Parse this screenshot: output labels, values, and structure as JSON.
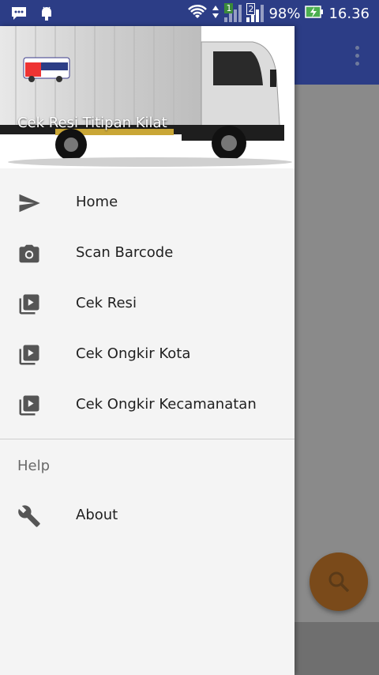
{
  "status": {
    "battery": "98%",
    "time": "16.36",
    "sim1": "1",
    "sim2": "2"
  },
  "drawer": {
    "header_title": "Cek Resi Titipan Kilat",
    "menu": [
      {
        "label": "Home",
        "icon": "send-icon"
      },
      {
        "label": "Scan Barcode",
        "icon": "camera-icon"
      },
      {
        "label": "Cek Resi",
        "icon": "video-library-icon"
      },
      {
        "label": "Cek Ongkir Kota",
        "icon": "video-library-icon"
      },
      {
        "label": "Cek Ongkir Kecamanatan",
        "icon": "video-library-icon"
      }
    ],
    "section_label": "Help",
    "about_label": "About"
  },
  "colors": {
    "primary": "#2c3d86",
    "fab": "#7a4a1a"
  }
}
